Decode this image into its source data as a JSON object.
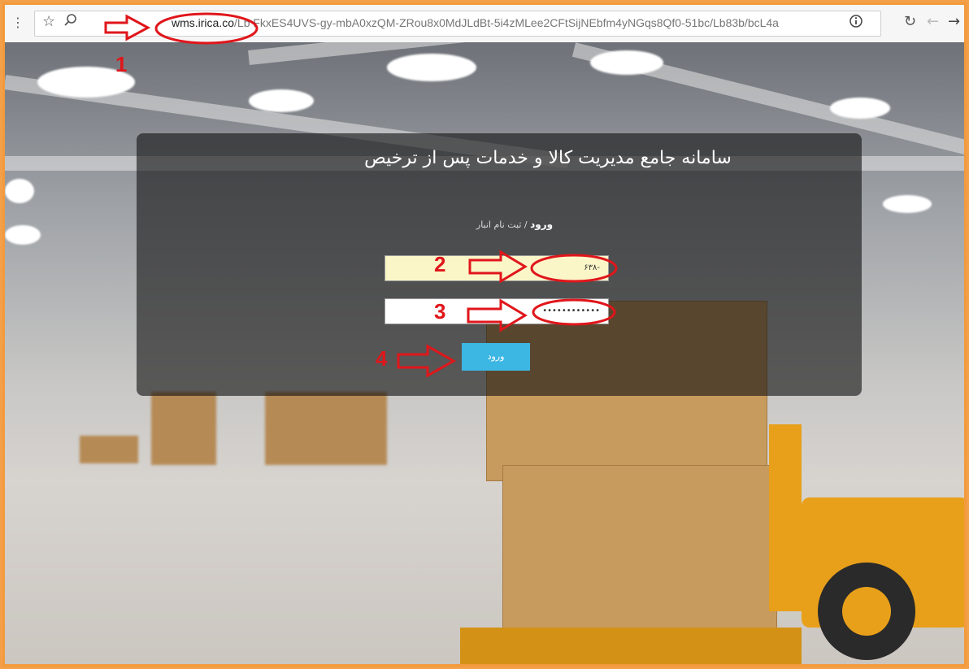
{
  "browser": {
    "url_domain": "wms.irica.co",
    "url_path": "/Lb FkxES4UVS-gy-mbA0xzQM-ZRou8x0MdJLdBt-5i4zMLee2CFtSijNEbfm4yNGqs8Qf0-51bc/Lb83b/bcL4a",
    "menu_icon": "more-vert-icon",
    "star_icon": "star-icon",
    "search_icon": "search-icon",
    "info_icon": "info-icon",
    "reload_icon": "reload-icon",
    "back_icon": "back-arrow-icon",
    "forward_icon": "forward-arrow-icon"
  },
  "login": {
    "title": "سامانه جامع مدیریت کالا و خدمات پس از ترخیص",
    "tab_login": "ورود",
    "tab_separator": "/",
    "tab_register": "ثبت نام انبار",
    "username_value": "۶۳۸-",
    "password_value": "••••••••••••",
    "submit_label": "ورود"
  },
  "annotations": {
    "labels": [
      "1",
      "2",
      "3",
      "4"
    ],
    "color": "#e0161b"
  },
  "colors": {
    "frame_border": "#f39a3c",
    "button_bg": "#3cb6e3",
    "username_bg": "#fbf6c8"
  }
}
